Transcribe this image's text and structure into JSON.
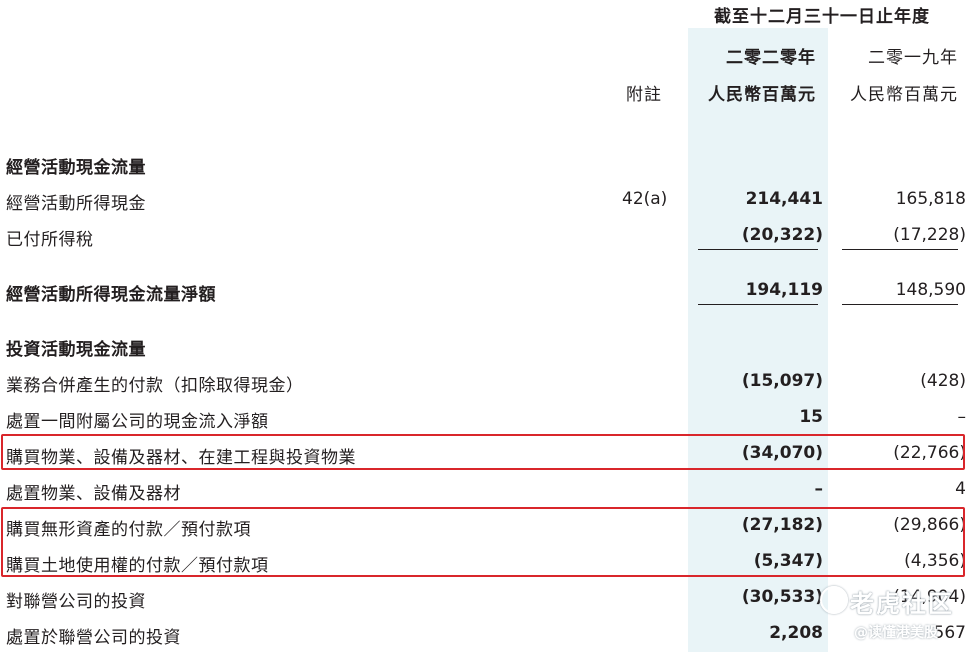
{
  "header": {
    "period": "截至十二月三十一日止年度",
    "year_current": "二零二零年",
    "year_prior": "二零一九年",
    "unit_current": "人民幣百萬元",
    "unit_prior": "人民幣百萬元",
    "note_label": "附註"
  },
  "rows": [
    {
      "label": "經營活動現金流量",
      "note": "",
      "current": "",
      "prior": ""
    },
    {
      "label": "經營活動所得現金",
      "note": "42(a)",
      "current": "214,441",
      "prior": "165,818"
    },
    {
      "label": "已付所得稅",
      "note": "",
      "current": "(20,322)",
      "prior": "(17,228)"
    },
    {
      "label": "經營活動所得現金流量淨額",
      "note": "",
      "current": "194,119",
      "prior": "148,590"
    },
    {
      "label": "投資活動現金流量",
      "note": "",
      "current": "",
      "prior": ""
    },
    {
      "label": "業務合併產生的付款（扣除取得現金）",
      "note": "",
      "current": "(15,097)",
      "prior": "(428)"
    },
    {
      "label": "處置一間附屬公司的現金流入淨額",
      "note": "",
      "current": "15",
      "prior": "–"
    },
    {
      "label": "購買物業、設備及器材、在建工程與投資物業",
      "note": "",
      "current": "(34,070)",
      "prior": "(22,766)"
    },
    {
      "label": "處置物業、設備及器材",
      "note": "",
      "current": "–",
      "prior": "4"
    },
    {
      "label": "購買無形資產的付款／預付款項",
      "note": "",
      "current": "(27,182)",
      "prior": "(29,866)"
    },
    {
      "label": "購買土地使用權的付款／預付款項",
      "note": "",
      "current": "(5,347)",
      "prior": "(4,356)"
    },
    {
      "label": "對聯營公司的投資",
      "note": "",
      "current": "(30,533)",
      "prior": "(14,904)"
    },
    {
      "label": "處置於聯營公司的投資",
      "note": "",
      "current": "2,208",
      "prior": "567"
    }
  ],
  "watermark": {
    "brand": "老虎社区",
    "handle": "@读懂港美股"
  },
  "colors": {
    "highlight_border": "#d9262b",
    "current_column_shade": "#e9f4f7",
    "text": "#231f20"
  }
}
